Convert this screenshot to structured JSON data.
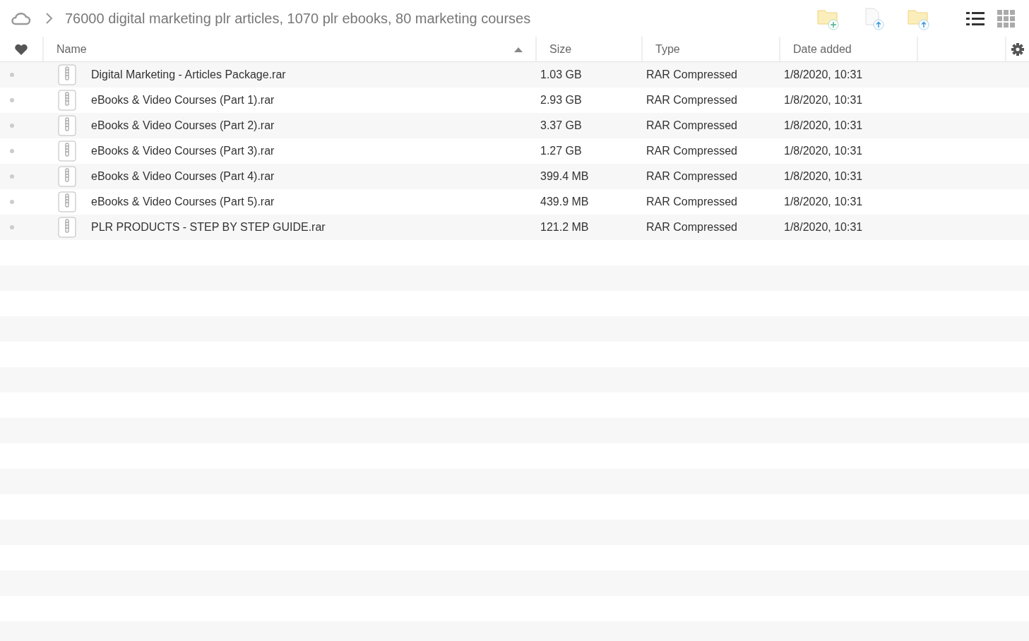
{
  "breadcrumb": {
    "title": "76000 digital marketing plr articles, 1070 plr ebooks, 80 marketing courses"
  },
  "view_modes": [
    {
      "kind": "list",
      "selected": true
    },
    {
      "kind": "grid",
      "selected": false
    }
  ],
  "table": {
    "columns": [
      {
        "label": "Name",
        "sorted": true
      },
      {
        "label": "Size",
        "sorted": false
      },
      {
        "label": "Type",
        "sorted": false
      },
      {
        "label": "Date added",
        "sorted": false
      }
    ],
    "rows": [
      {
        "name": "Digital Marketing - Articles Package.rar",
        "size": "1.03 GB",
        "type": "RAR Compressed",
        "date": "1/8/2020, 10:31"
      },
      {
        "name": "eBooks & Video Courses (Part 1).rar",
        "size": "2.93 GB",
        "type": "RAR Compressed",
        "date": "1/8/2020, 10:31"
      },
      {
        "name": "eBooks & Video Courses (Part 2).rar",
        "size": "3.37 GB",
        "type": "RAR Compressed",
        "date": "1/8/2020, 10:31"
      },
      {
        "name": "eBooks & Video Courses (Part 3).rar",
        "size": "1.27 GB",
        "type": "RAR Compressed",
        "date": "1/8/2020, 10:31"
      },
      {
        "name": "eBooks & Video Courses (Part 4).rar",
        "size": "399.4 MB",
        "type": "RAR Compressed",
        "date": "1/8/2020, 10:31"
      },
      {
        "name": "eBooks & Video Courses (Part 5).rar",
        "size": "439.9 MB",
        "type": "RAR Compressed",
        "date": "1/8/2020, 10:31"
      },
      {
        "name": "PLR PRODUCTS - STEP BY STEP GUIDE.rar",
        "size": "121.2 MB",
        "type": "RAR Compressed",
        "date": "1/8/2020, 10:31"
      }
    ]
  }
}
